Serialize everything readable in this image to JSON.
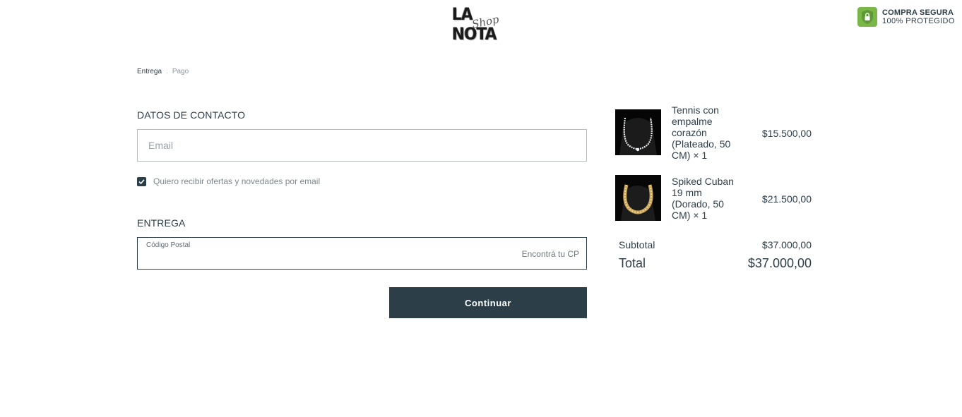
{
  "header": {
    "logo_text": "LA NOTA",
    "logo_script": "Shop",
    "secure_title": "COMPRA SEGURA",
    "secure_subtitle": "100% PROTEGIDO",
    "shield_color": "#7ab648"
  },
  "breadcrumb": {
    "current": "Entrega",
    "separator": ".",
    "next": "Pago"
  },
  "contact": {
    "title": "DATOS DE CONTACTO",
    "email_placeholder": "Email",
    "email_value": "",
    "optin_label": "Quiero recibir ofertas y novedades por email",
    "optin_checked": true
  },
  "delivery": {
    "title": "ENTREGA",
    "zip_label": "Código Postal",
    "zip_link": "Encontrá tu CP"
  },
  "actions": {
    "continue_label": "Continuar"
  },
  "cart": {
    "items": [
      {
        "name": "Tennis con empalme corazón (Plateado, 50 CM) × 1",
        "price": "$15.500,00",
        "image": "silver-tennis-necklace"
      },
      {
        "name": "Spiked Cuban 19 mm (Dorado, 50 CM) × 1",
        "price": "$21.500,00",
        "image": "gold-cuban-chain"
      }
    ],
    "subtotal_label": "Subtotal",
    "subtotal_value": "$37.000,00",
    "total_label": "Total",
    "total_value": "$37.000,00"
  },
  "colors": {
    "primary": "#2c3e48",
    "muted": "#7b868c",
    "border": "#b9bcbe"
  }
}
